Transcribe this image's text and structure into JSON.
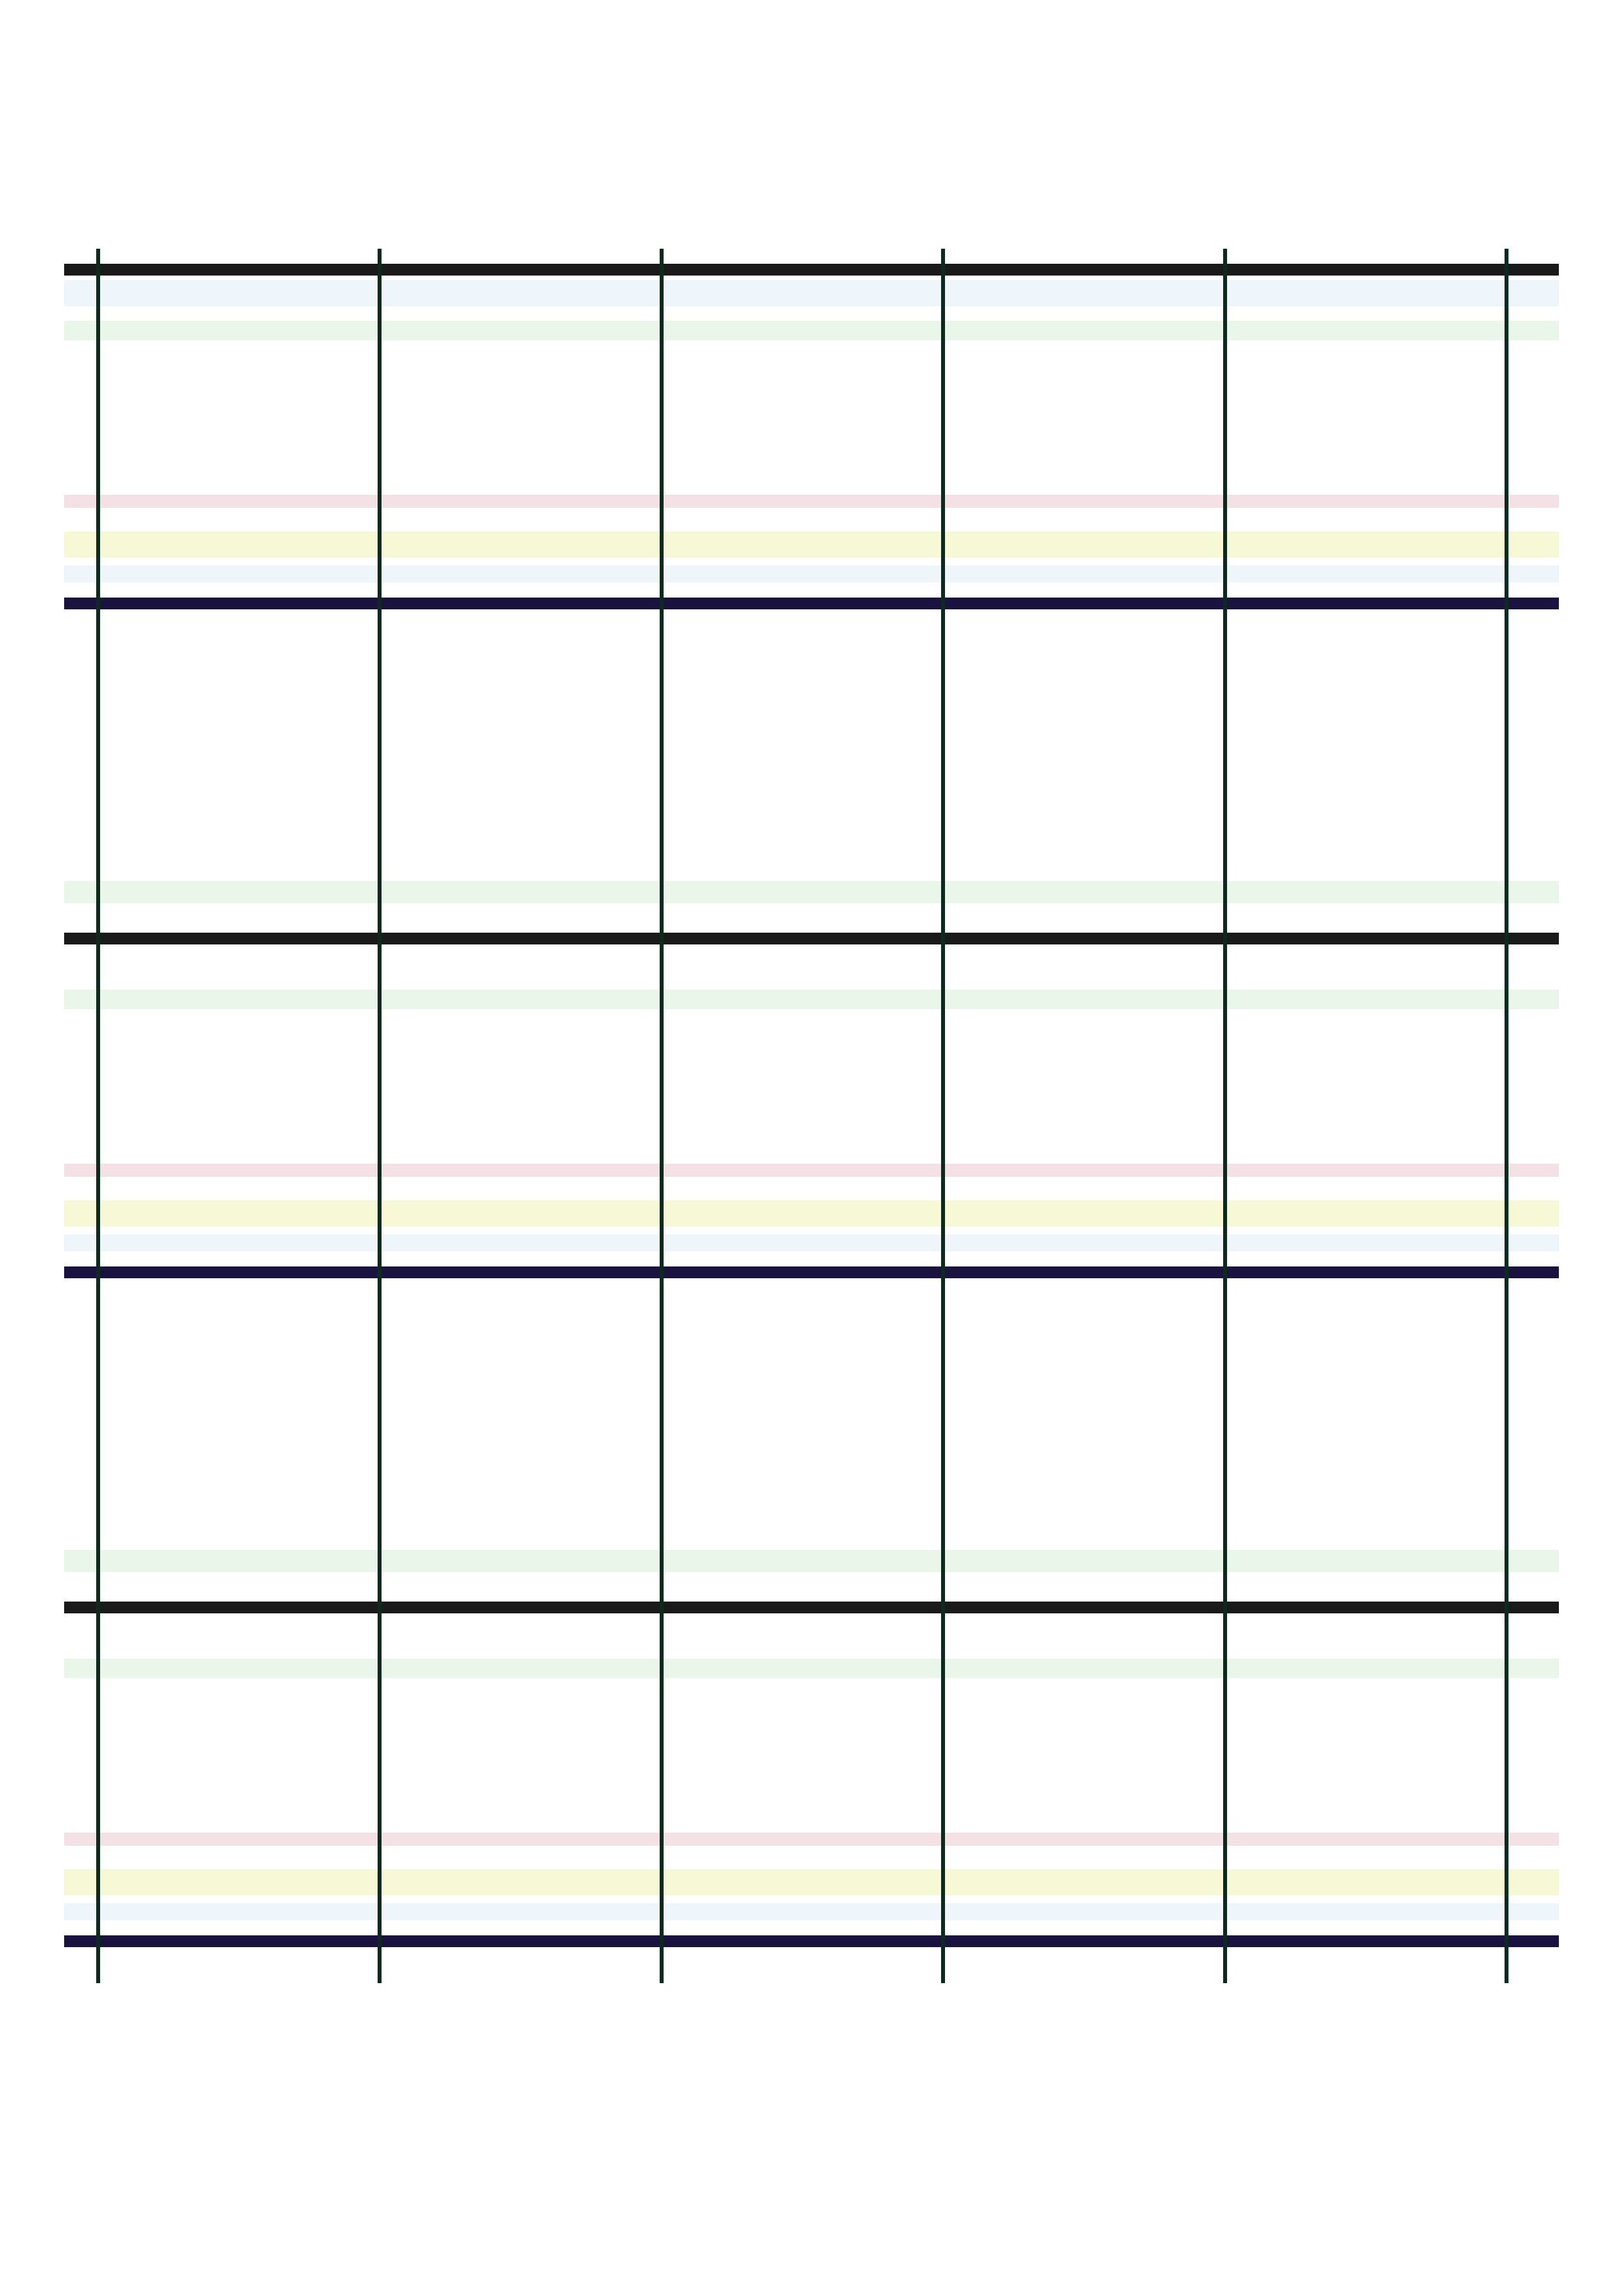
{
  "page": {
    "background_color": "#ffffff"
  },
  "grid": {
    "description_visible_text": "",
    "column_count": 5,
    "row_band_count": 5,
    "colors": {
      "thick_rule_dark": "#1a1a1a",
      "thick_rule_navy": "#1a1340",
      "vertical_rule": "#0d2a1e",
      "tint_green": "#eaf6ea",
      "tint_pink": "#f3e1e6",
      "tint_yellow": "#f6f8d6",
      "tint_blue": "#eef6fb"
    }
  }
}
